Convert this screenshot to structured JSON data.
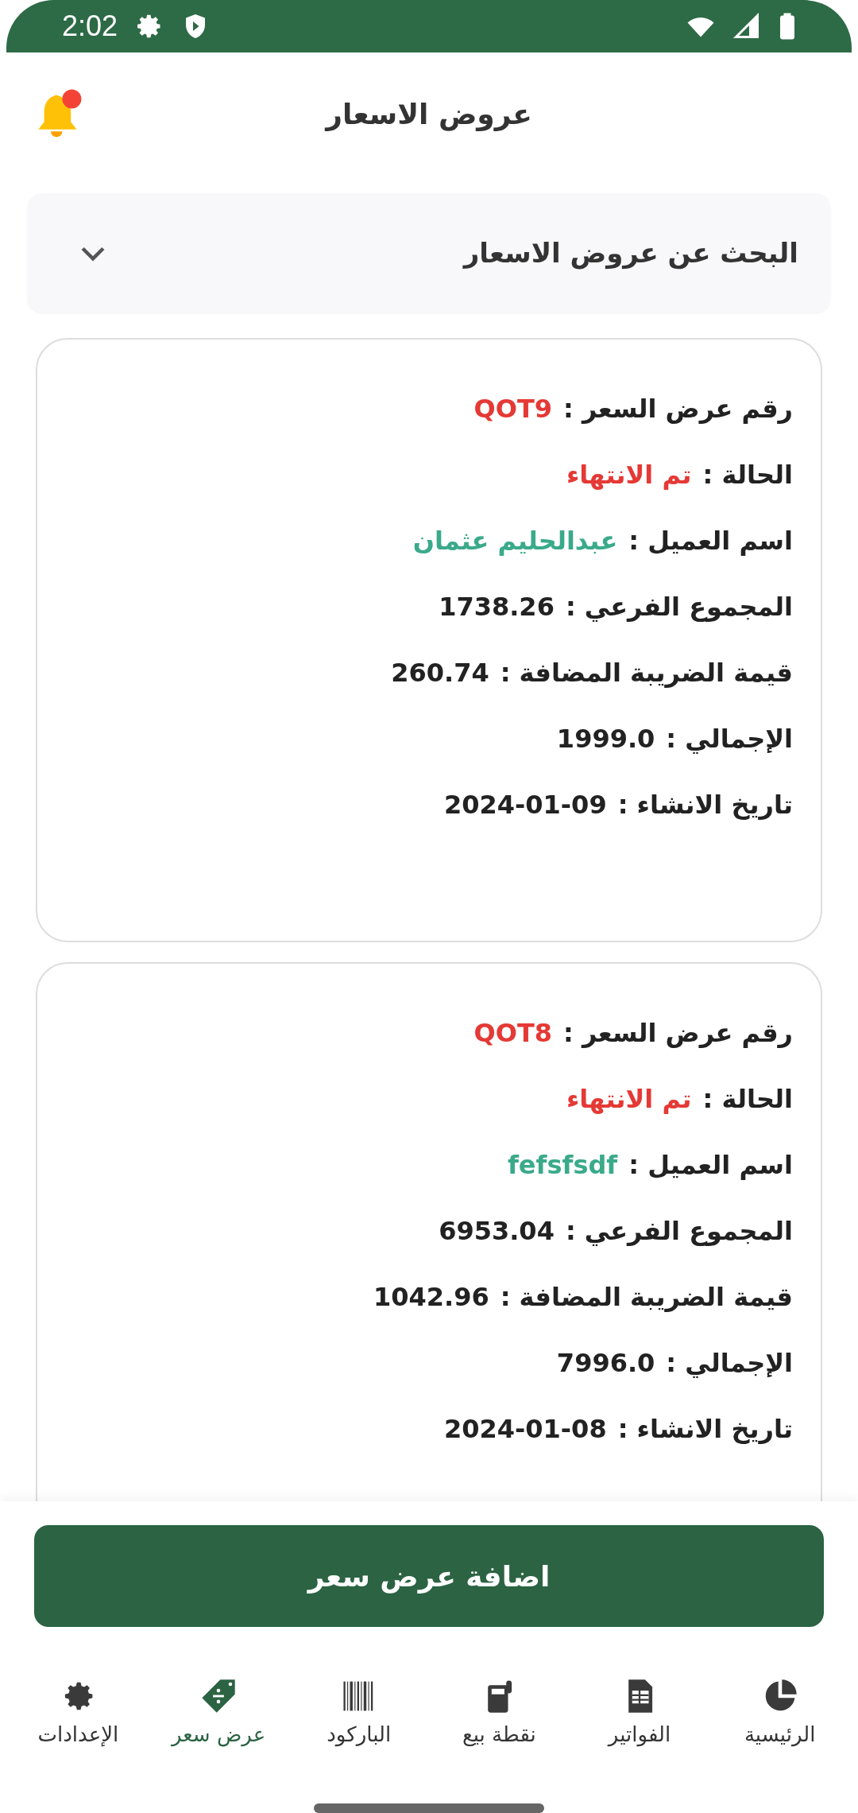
{
  "status_bar": {
    "time": "2:02"
  },
  "header": {
    "title": "عروض الاسعار",
    "notification_dot": true
  },
  "search": {
    "label": "البحث عن عروض الاسعار",
    "expanded": false
  },
  "quotes": [
    {
      "rows": [
        {
          "label": "رقم عرض السعر :",
          "value": "QOT9",
          "kind": "code"
        },
        {
          "label": "الحالة :",
          "value": "تم الانتهاء",
          "kind": "status"
        },
        {
          "label": "اسم العميل :",
          "value": "عبدالحليم عثمان",
          "kind": "customer"
        },
        {
          "label": "المجموع الفرعي :",
          "value": "1738.26",
          "kind": "amount"
        },
        {
          "label": "قيمة الضريبة المضافة :",
          "value": "260.74",
          "kind": "amount"
        },
        {
          "label": "الإجمالي :",
          "value": "1999.0",
          "kind": "amount"
        },
        {
          "label": "تاريخ الانشاء :",
          "value": "2024-01-09",
          "kind": "amount"
        }
      ]
    },
    {
      "rows": [
        {
          "label": "رقم عرض السعر :",
          "value": "QOT8",
          "kind": "code"
        },
        {
          "label": "الحالة :",
          "value": "تم الانتهاء",
          "kind": "status"
        },
        {
          "label": "اسم العميل :",
          "value": "fefsfsdf",
          "kind": "customer"
        },
        {
          "label": "المجموع الفرعي :",
          "value": "6953.04",
          "kind": "amount"
        },
        {
          "label": "قيمة الضريبة المضافة :",
          "value": "1042.96",
          "kind": "amount"
        },
        {
          "label": "الإجمالي :",
          "value": "7996.0",
          "kind": "amount"
        },
        {
          "label": "تاريخ الانشاء :",
          "value": "2024-01-08",
          "kind": "amount"
        }
      ]
    }
  ],
  "add_button": "اضافة عرض سعر",
  "nav": [
    {
      "label": "الرئيسية",
      "selected": false
    },
    {
      "label": "الفواتير",
      "selected": false
    },
    {
      "label": "نقطة بيع",
      "selected": false
    },
    {
      "label": "الباركود",
      "selected": false
    },
    {
      "label": "عرض سعر",
      "selected": true
    },
    {
      "label": "الإعدادات",
      "selected": false
    }
  ]
}
